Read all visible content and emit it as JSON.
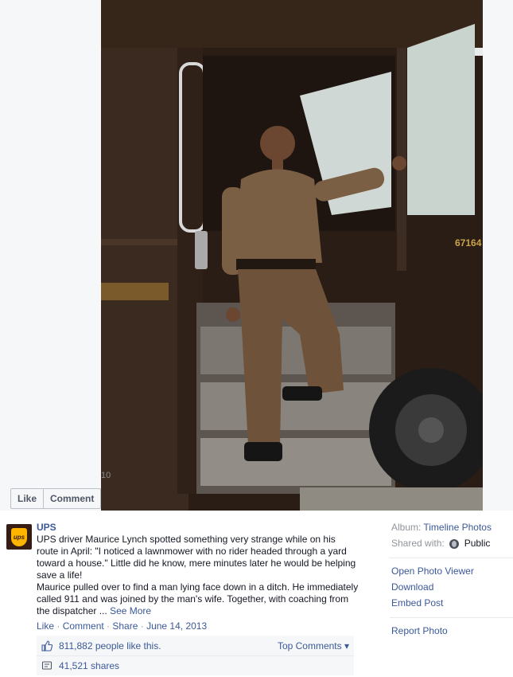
{
  "photo": {
    "truck_number": "67164",
    "truck_fragment": "10",
    "actions": {
      "like_label": "Like",
      "comment_label": "Comment"
    }
  },
  "post": {
    "author": "UPS",
    "caption": "UPS driver Maurice Lynch spotted something very strange while on his route in April: \"I noticed a lawnmower with no rider headed through a yard toward a house.\" Little did he know, mere minutes later he would be helping save a life!\nMaurice pulled over to find a man lying face down in a ditch. He immediately called 911 and was joined by the man's wife. Together, with coaching from the dispatcher ... ",
    "see_more": "See More",
    "meta": {
      "like": "Like",
      "comment": "Comment",
      "share": "Share",
      "separator": " · ",
      "date": "June 14, 2013"
    }
  },
  "ufi": {
    "likes_text": "811,882 people like this.",
    "top_comments": "Top Comments ▾",
    "shares_text": "41,521 shares"
  },
  "sidebar": {
    "album_label": "Album:",
    "album_value": "Timeline Photos",
    "shared_label": "Shared with:",
    "shared_value": "Public",
    "actions": [
      "Open Photo Viewer",
      "Download",
      "Embed Post"
    ],
    "report": "Report Photo"
  },
  "colors": {
    "link": "#3b5998",
    "ups_brown": "#351c15",
    "ups_gold": "#ffb500"
  }
}
